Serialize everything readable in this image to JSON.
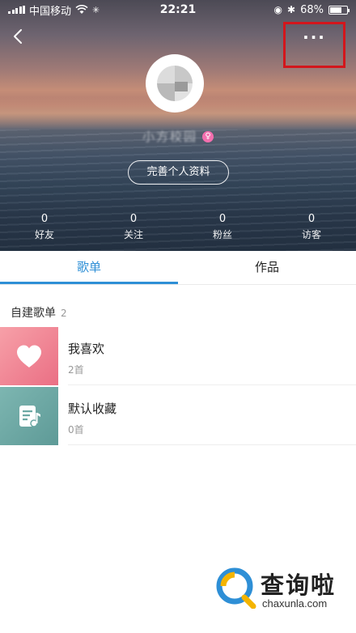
{
  "status_bar": {
    "carrier": "中国移动",
    "time": "22:21",
    "battery_percent": "68%",
    "battery_level": 0.68
  },
  "header": {
    "nickname": "小方校园",
    "complete_profile_button": "完善个人资料",
    "stats": [
      {
        "value": "0",
        "label": "好友"
      },
      {
        "value": "0",
        "label": "关注"
      },
      {
        "value": "0",
        "label": "粉丝"
      },
      {
        "value": "0",
        "label": "访客"
      }
    ]
  },
  "tabs": [
    {
      "label": "歌单",
      "active": true
    },
    {
      "label": "作品",
      "active": false
    }
  ],
  "section": {
    "title": "自建歌单",
    "count": "2"
  },
  "playlists": [
    {
      "name": "我喜欢",
      "count_text": "2首",
      "icon": "heart-icon",
      "color": "#f08090"
    },
    {
      "name": "默认收藏",
      "count_text": "0首",
      "icon": "music-note-icon",
      "color": "#6aa7a3"
    }
  ],
  "colors": {
    "accent": "#2e8fd6",
    "highlight_box": "#d3161c"
  },
  "watermark": {
    "brand_text": "查询啦",
    "url": "chaxunla.com"
  }
}
